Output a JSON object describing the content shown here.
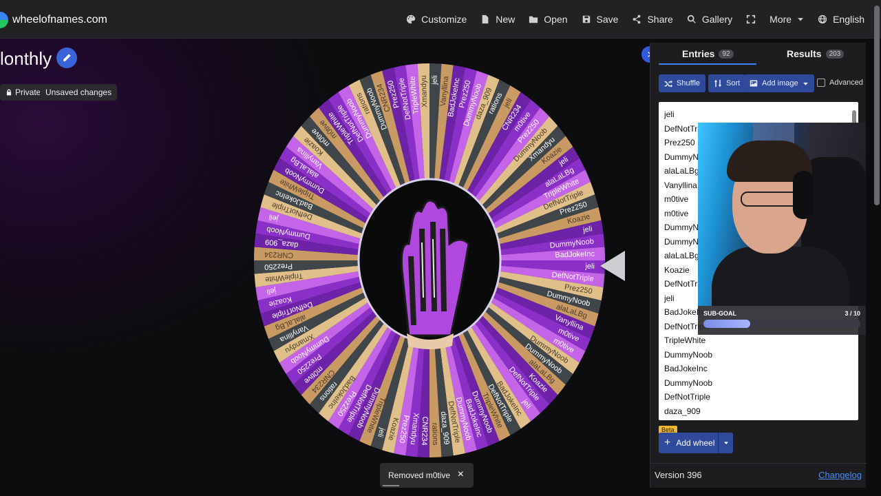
{
  "site": {
    "name": "wheelofnames.com"
  },
  "nav": [
    {
      "id": "customize",
      "label": "Customize",
      "icon": "palette-icon"
    },
    {
      "id": "new",
      "label": "New",
      "icon": "file-icon"
    },
    {
      "id": "open",
      "label": "Open",
      "icon": "folder-icon"
    },
    {
      "id": "save",
      "label": "Save",
      "icon": "save-icon"
    },
    {
      "id": "share",
      "label": "Share",
      "icon": "share-icon"
    },
    {
      "id": "gallery",
      "label": "Gallery",
      "icon": "search-icon"
    },
    {
      "id": "fullscreen",
      "label": "",
      "icon": "fullscreen-icon"
    },
    {
      "id": "more",
      "label": "More",
      "icon": "chevron-down-icon"
    },
    {
      "id": "language",
      "label": "English",
      "icon": "globe-icon"
    }
  ],
  "wheel": {
    "title": "lonthly",
    "privacy": "Private",
    "status": "Unsaved changes",
    "colors": [
      "#8b2fc9",
      "#c464e8",
      "#e0bf8a",
      "#3f4548",
      "#c99a64",
      "#6e22a8"
    ],
    "labels": [
      "jeli",
      "DefNotTriple",
      "Prez250",
      "DummyNoob",
      "alaLaLBg",
      "Vanyllina",
      "m0tive",
      "m0tive",
      "DummyNoob",
      "DummyNoob",
      "alaLaLBg",
      "Koazie",
      "DefNotTriple",
      "jeli",
      "BadJokeInc",
      "DefNotTriple",
      "TripleWhite",
      "DummyNoob",
      "BadJokeInc",
      "DummyNoob",
      "DefNotTriple",
      "daza_909",
      "rations",
      "CNR234",
      "Xmandyu",
      "Prez250",
      "Koazie",
      "jeli",
      "TripleWhite",
      "DummyNoob",
      "DefNotTriple",
      "Prez250",
      "BadJokeInc",
      "rations",
      "CNR234",
      "m0tive",
      "Prez250",
      "DummyNoob",
      "Xmandyu",
      "Vanyllina",
      "alaLaLBg",
      "DefNotTriple",
      "Koazie",
      "jeli",
      "TripleWhite",
      "Prez250",
      "CNR234",
      "daza_909",
      "DummyNoob",
      "jeli",
      "DefNotTriple",
      "BadJokeInc",
      "TripleWhite",
      "DummyNoob",
      "alaLaLBg",
      "Vanyllina",
      "Koazie",
      "m0tive",
      "m0tive",
      "TripleWhite",
      "DefNotTriple",
      "DummyNoob",
      "rations",
      "DummyNoob",
      "CNR234",
      "Prez250",
      "DefNotTriple",
      "TripleWhite",
      "Xmandyu",
      "jeli",
      "Vanyllina",
      "BadJokeInc",
      "Prez250",
      "DummyNoob",
      "daza_909",
      "rations",
      "jeli",
      "CNR234",
      "m0tive",
      "Prez250",
      "DummyNoob",
      "Xmandyu",
      "Koazie",
      "jeli",
      "alaLaLBg",
      "TripleWhite",
      "DefNotTriple",
      "Prez250",
      "Koazie",
      "jeli",
      "DummyNoob",
      "BadJokeInc"
    ]
  },
  "toast": {
    "message": "Removed m0tive",
    "close": "×"
  },
  "panel": {
    "tabs": [
      {
        "label": "Entries",
        "count": "92"
      },
      {
        "label": "Results",
        "count": "203"
      }
    ],
    "buttons": {
      "shuffle": "Shuffle",
      "sort": "Sort",
      "add_image": "Add image"
    },
    "advanced": "Advanced",
    "entries": [
      "jeli",
      "DefNotTriple",
      "Prez250",
      "DummyNoob",
      "alaLaLBg",
      "Vanyllina",
      "m0tive",
      "m0tive",
      "DummyNoob",
      "DummyNoob",
      "alaLaLBg",
      "Koazie",
      "DefNotTriple",
      "jeli",
      "BadJokeInc",
      "DefNotTriple",
      "TripleWhite",
      "DummyNoob",
      "BadJokeInc",
      "DummyNoob",
      "DefNotTriple",
      "daza_909"
    ],
    "beta": "Beta",
    "add_wheel": "Add wheel",
    "version": "Version 396",
    "changelog": "Changelog"
  },
  "overlay": {
    "subgoal_label": "SUB-GOAL",
    "subgoal_value": "3 / 10",
    "subgoal_progress": 0.3
  }
}
